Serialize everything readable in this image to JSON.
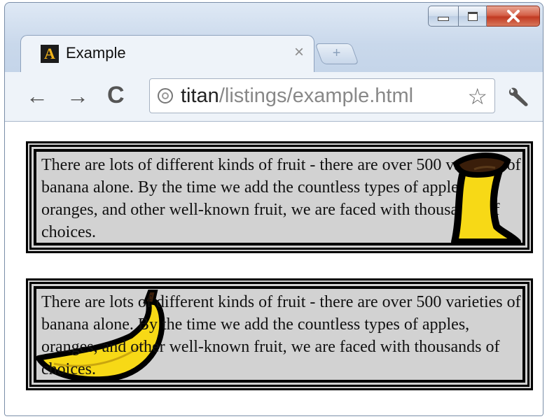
{
  "window": {
    "tab": {
      "title": "Example",
      "favicon_letter": "A",
      "close_glyph": "×"
    },
    "new_tab_glyph": "+"
  },
  "toolbar": {
    "back_glyph": "←",
    "forward_glyph": "→",
    "reload_glyph": "C",
    "url_host": "titan",
    "url_path": "/listings/example.html",
    "star_glyph": "☆"
  },
  "content": {
    "paragraphs": [
      {
        "text": "There are lots of different kinds of fruit - there are over 500 varieties of banana alone. By the time we add the countless types of apples, oranges, and other well-known fruit, we are faced with thousands of choices.",
        "image": "standing-banana"
      },
      {
        "text": "There are lots of different kinds of fruit - there are over 500 varieties of banana alone. By the time we add the countless types of apples, oranges, and other well-known fruit, we are faced with thousands of choices.",
        "image": "lying-banana"
      }
    ]
  },
  "colors": {
    "box_background": "#d2d2d2",
    "banana_yellow": "#f7d916",
    "banana_stem": "#3a1e0a",
    "close_red": "#c8432a"
  }
}
